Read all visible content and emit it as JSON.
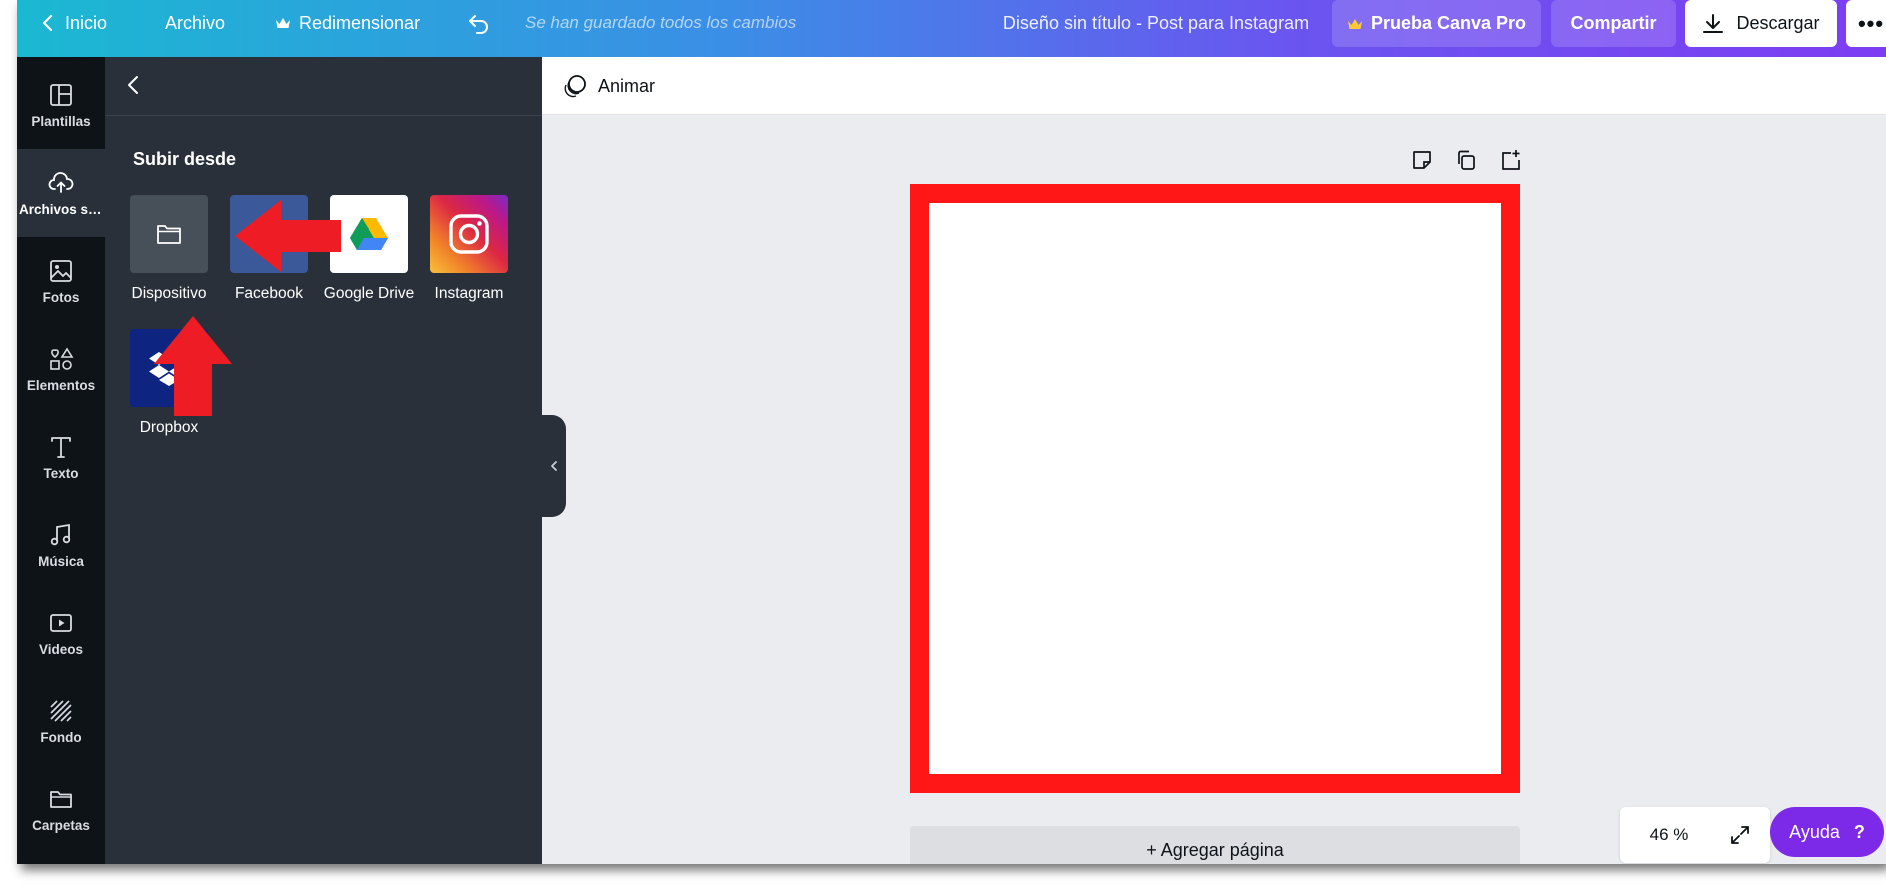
{
  "topbar": {
    "home_label": "Inicio",
    "file_label": "Archivo",
    "resize_label": "Redimensionar",
    "saved_status": "Se han guardado todos los cambios",
    "design_title": "Diseño sin título - Post para Instagram",
    "pro_label": "Prueba Canva Pro",
    "share_label": "Compartir",
    "download_label": "Descargar",
    "more_label": "•••"
  },
  "rail": {
    "items": [
      {
        "label": "Plantillas",
        "icon": "layout-icon"
      },
      {
        "label": "Archivos subidos",
        "icon": "cloud-upload-icon",
        "active": true
      },
      {
        "label": "Fotos",
        "icon": "photo-icon"
      },
      {
        "label": "Elementos",
        "icon": "shapes-icon"
      },
      {
        "label": "Texto",
        "icon": "text-icon"
      },
      {
        "label": "Música",
        "icon": "music-icon"
      },
      {
        "label": "Videos",
        "icon": "video-icon"
      },
      {
        "label": "Fondo",
        "icon": "background-icon"
      },
      {
        "label": "Carpetas",
        "icon": "folder-icon"
      }
    ]
  },
  "panel": {
    "heading": "Subir desde",
    "sources": [
      {
        "label": "Dispositivo",
        "icon": "folder-icon",
        "color": "#474f59"
      },
      {
        "label": "Facebook",
        "icon": "facebook-icon",
        "color": "#3b5998"
      },
      {
        "label": "Google Drive",
        "icon": "google-drive-icon",
        "color": "#ffffff"
      },
      {
        "label": "Instagram",
        "icon": "instagram-icon",
        "color": "#dc2743"
      },
      {
        "label": "Dropbox",
        "icon": "dropbox-icon",
        "color": "#0d2481"
      }
    ]
  },
  "canvas": {
    "animate_label": "Animar",
    "add_page_label": "+ Agregar página",
    "zoom_label": "46 %",
    "help_label": "Ayuda",
    "help_icon_label": "?",
    "highlight_color": "#ff1717"
  },
  "colors": {
    "accent": "#7d2ae8",
    "annotation": "#ee1c25"
  }
}
